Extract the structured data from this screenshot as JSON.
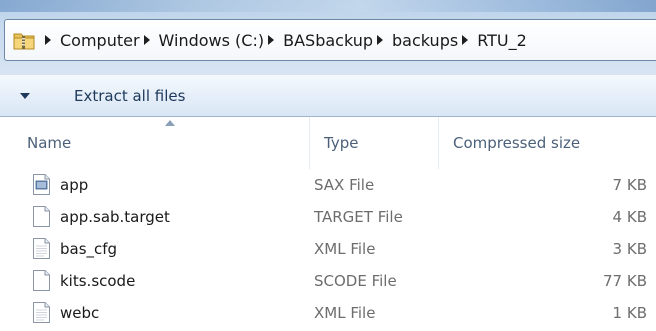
{
  "address_bar": {
    "breadcrumbs": [
      "Computer",
      "Windows (C:)",
      "BASbackup",
      "backups",
      "RTU_2"
    ],
    "icon": "folder-zip-icon"
  },
  "toolbar": {
    "extract_label": "Extract all files"
  },
  "columns": {
    "name": "Name",
    "type": "Type",
    "size": "Compressed size"
  },
  "files": [
    {
      "name": "app",
      "type": "SAX File",
      "size": "7 KB",
      "icon": "file-lines-icon"
    },
    {
      "name": "app.sab.target",
      "type": "TARGET File",
      "size": "4 KB",
      "icon": "file-blank-icon"
    },
    {
      "name": "bas_cfg",
      "type": "XML File",
      "size": "3 KB",
      "icon": "file-text-icon"
    },
    {
      "name": "kits.scode",
      "type": "SCODE File",
      "size": "77 KB",
      "icon": "file-blank-icon"
    },
    {
      "name": "webc",
      "type": "XML File",
      "size": "1 KB",
      "icon": "file-text-icon"
    }
  ]
}
